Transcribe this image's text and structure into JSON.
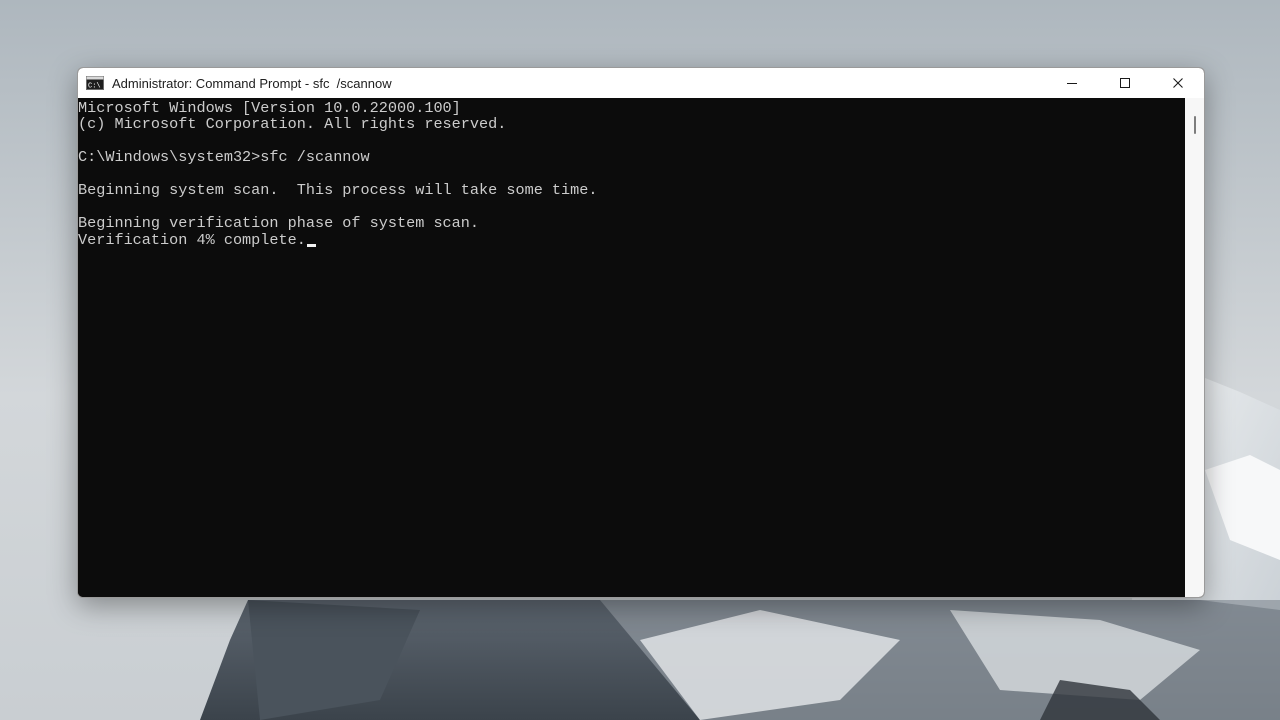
{
  "window": {
    "title": "Administrator: Command Prompt - sfc  /scannow",
    "icon": "cmd-icon"
  },
  "controls": {
    "minimize_icon": "minimize-icon",
    "maximize_icon": "maximize-icon",
    "close_icon": "close-icon"
  },
  "console": {
    "lines": [
      "Microsoft Windows [Version 10.0.22000.100]",
      "(c) Microsoft Corporation. All rights reserved.",
      "",
      "C:\\Windows\\system32>sfc /scannow",
      "",
      "Beginning system scan.  This process will take some time.",
      "",
      "Beginning verification phase of system scan.",
      "Verification 4% complete."
    ],
    "text_color": "#cccccc",
    "background": "#0c0c0c"
  }
}
